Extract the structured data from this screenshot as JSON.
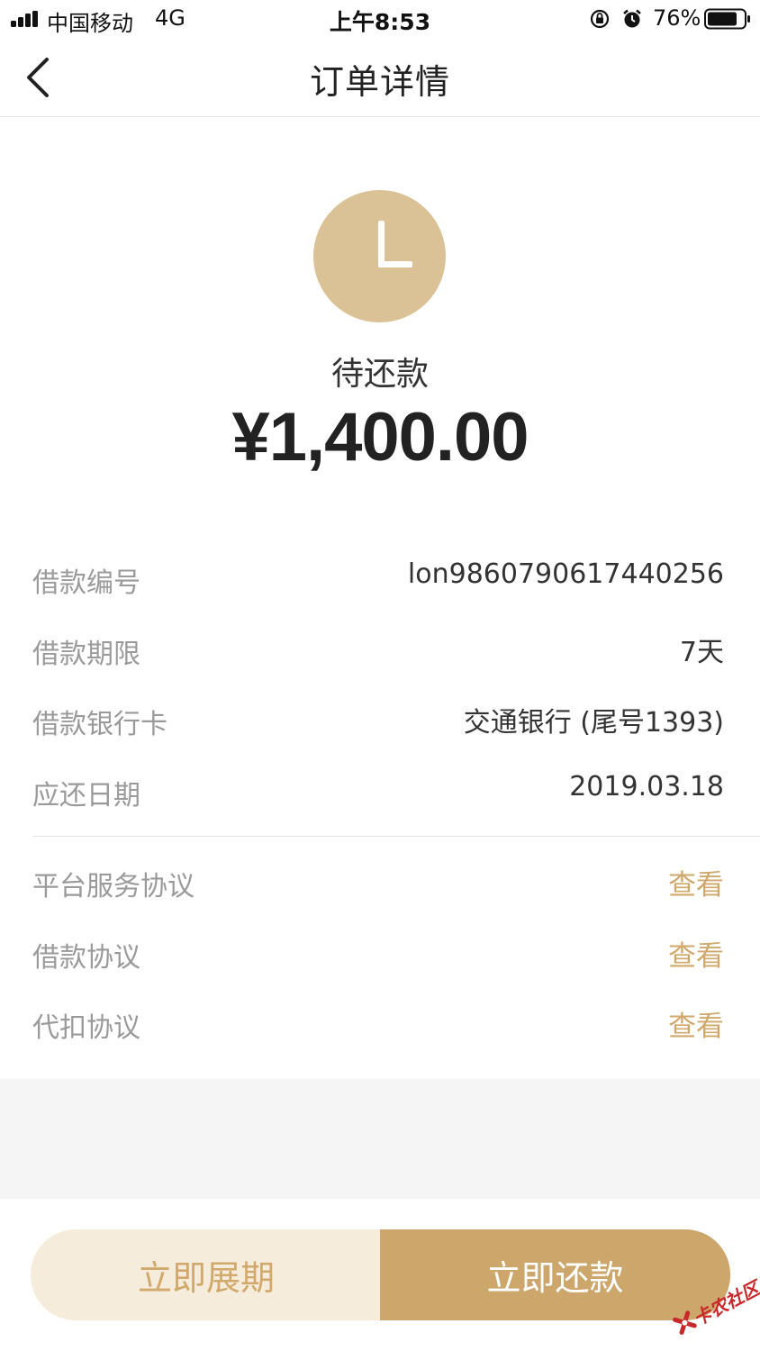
{
  "status_bar": {
    "carrier": "中国移动",
    "network": "4G",
    "time": "上午8:53",
    "battery_percent": "76%"
  },
  "nav": {
    "title": "订单详情"
  },
  "order": {
    "status_letter": "L",
    "status_label": "待还款",
    "amount": "¥1,400.00"
  },
  "details": [
    {
      "label": "借款编号",
      "value": "lon9860790617440256"
    },
    {
      "label": "借款期限",
      "value": "7天"
    },
    {
      "label": "借款银行卡",
      "value": "交通银行 (尾号1393)"
    },
    {
      "label": "应还日期",
      "value": "2019.03.18"
    }
  ],
  "agreements": [
    {
      "label": "平台服务协议",
      "link": "查看"
    },
    {
      "label": "借款协议",
      "link": "查看"
    },
    {
      "label": "代扣协议",
      "link": "查看"
    }
  ],
  "actions": {
    "extend_label": "立即展期",
    "repay_label": "立即还款"
  },
  "watermark": {
    "text": "卡农社区"
  },
  "colors": {
    "accent_gold": "#cca66a",
    "accent_light": "#f6ecdb",
    "link_gold": "#d0a86b",
    "status_circle": "#dac196"
  }
}
